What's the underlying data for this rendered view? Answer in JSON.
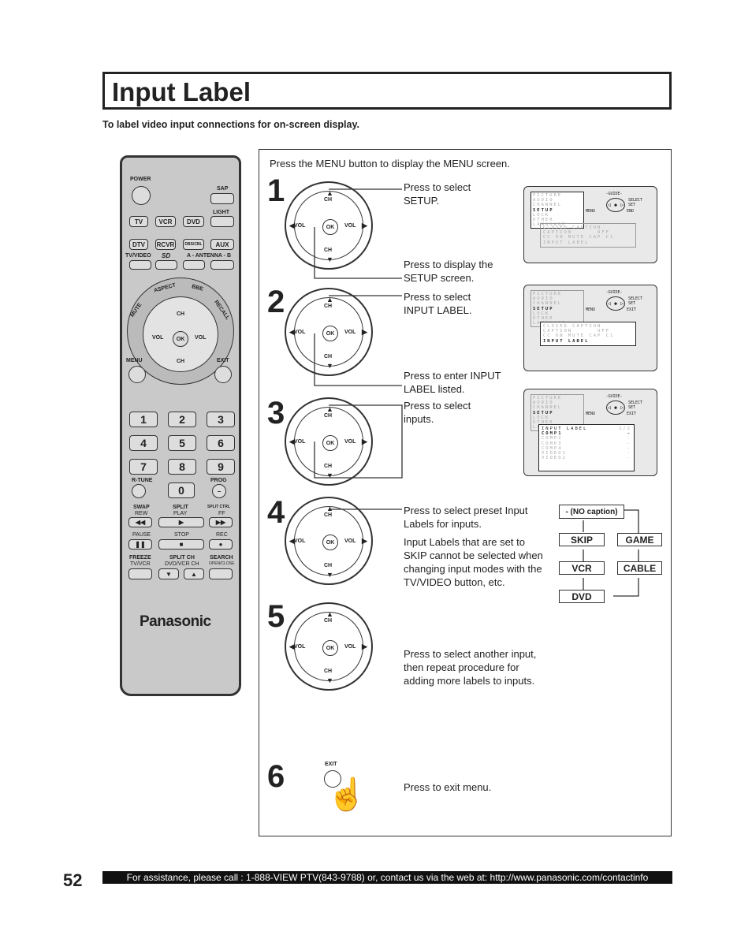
{
  "page": {
    "title": "Input Label",
    "subtitle": "To label video input connections for on-screen display.",
    "page_number": "52",
    "footer": "For assistance, please call : 1-888-VIEW PTV(843-9788) or, contact us via the web at: http://www.panasonic.com/contactinfo"
  },
  "remote": {
    "brand": "Panasonic",
    "power": "POWER",
    "sap": "SAP",
    "light": "LIGHT",
    "tv": "TV",
    "vcr": "VCR",
    "dvd": "DVD",
    "dtv": "DTV",
    "rcvr": "RCVR",
    "dbs": "DBS/CBL",
    "aux": "AUX",
    "tvvideo": "TV/VIDEO",
    "sd": "SD",
    "antenna": "A - ANTENNA - B",
    "mute": "MUTE",
    "aspect": "ASPECT",
    "bbe": "BBE",
    "recall": "RECALL",
    "ch": "CH",
    "vol": "VOL",
    "ok": "OK",
    "menu": "MENU",
    "exit": "EXIT",
    "numbers": [
      "1",
      "2",
      "3",
      "4",
      "5",
      "6",
      "7",
      "8",
      "9"
    ],
    "zero": "0",
    "rtune": "R-TUNE",
    "prog": "PROG",
    "swap": "SWAP",
    "rew": "REW",
    "split": "SPLIT",
    "play": "PLAY",
    "splitctrl": "SPLIT CTRL",
    "ff": "FF",
    "pause": "PAUSE",
    "stop": "STOP",
    "rec": "REC",
    "freeze": "FREEZE",
    "tvvcr": "TV/VCR",
    "splitch": "SPLIT CH",
    "dvdvcrch": "DVD/VCR CH",
    "search": "SEARCH",
    "openclose": "OPEN/CLOSE"
  },
  "steps": {
    "intro": "Press the MENU button to display the MENU screen.",
    "numbers": [
      "1",
      "2",
      "3",
      "4",
      "5",
      "6"
    ],
    "s1a": "Press to select SETUP.",
    "s1b": "Press to display the SETUP screen.",
    "s2a": "Press to select INPUT LABEL.",
    "s2b": "Press to enter INPUT LABEL listed.",
    "s3": "Press to select inputs.",
    "s4a": "Press to select preset Input Labels for inputs.",
    "s4b": "Input Labels that are set to SKIP cannot be selected when changing input modes with the TV/VIDEO button, etc.",
    "s5": "Press to select another input, then repeat procedure for adding more labels to inputs.",
    "s6": "Press to exit menu.",
    "exit_label": "EXIT"
  },
  "menu_screen": {
    "items": [
      "PICTURE",
      "AUDIO",
      "CHANNEL",
      "SETUP",
      "LOCK",
      "OTHER",
      "LANGUAGE"
    ],
    "guide": "-GUIDE-",
    "select": "SELECT",
    "set": "SET",
    "menu": "MENU",
    "end": "END",
    "exit": "EXIT",
    "setup_items": [
      "CLOSED CAPTION",
      "CAPTION      OFF",
      "CC ON MUTE CAP C1",
      "INPUT LABEL"
    ],
    "input_label_title": "INPUT LABEL",
    "input_label_page": "1/2",
    "inputs": [
      "COMP1",
      "COMP2",
      "COMP3",
      "COMP4",
      "VIDEO1",
      "VIDEO2"
    ],
    "input_value": "-"
  },
  "flow": {
    "no_caption": "- (NO caption)",
    "skip": "SKIP",
    "game": "GAME",
    "vcr": "VCR",
    "cable": "CABLE",
    "dvd": "DVD"
  }
}
